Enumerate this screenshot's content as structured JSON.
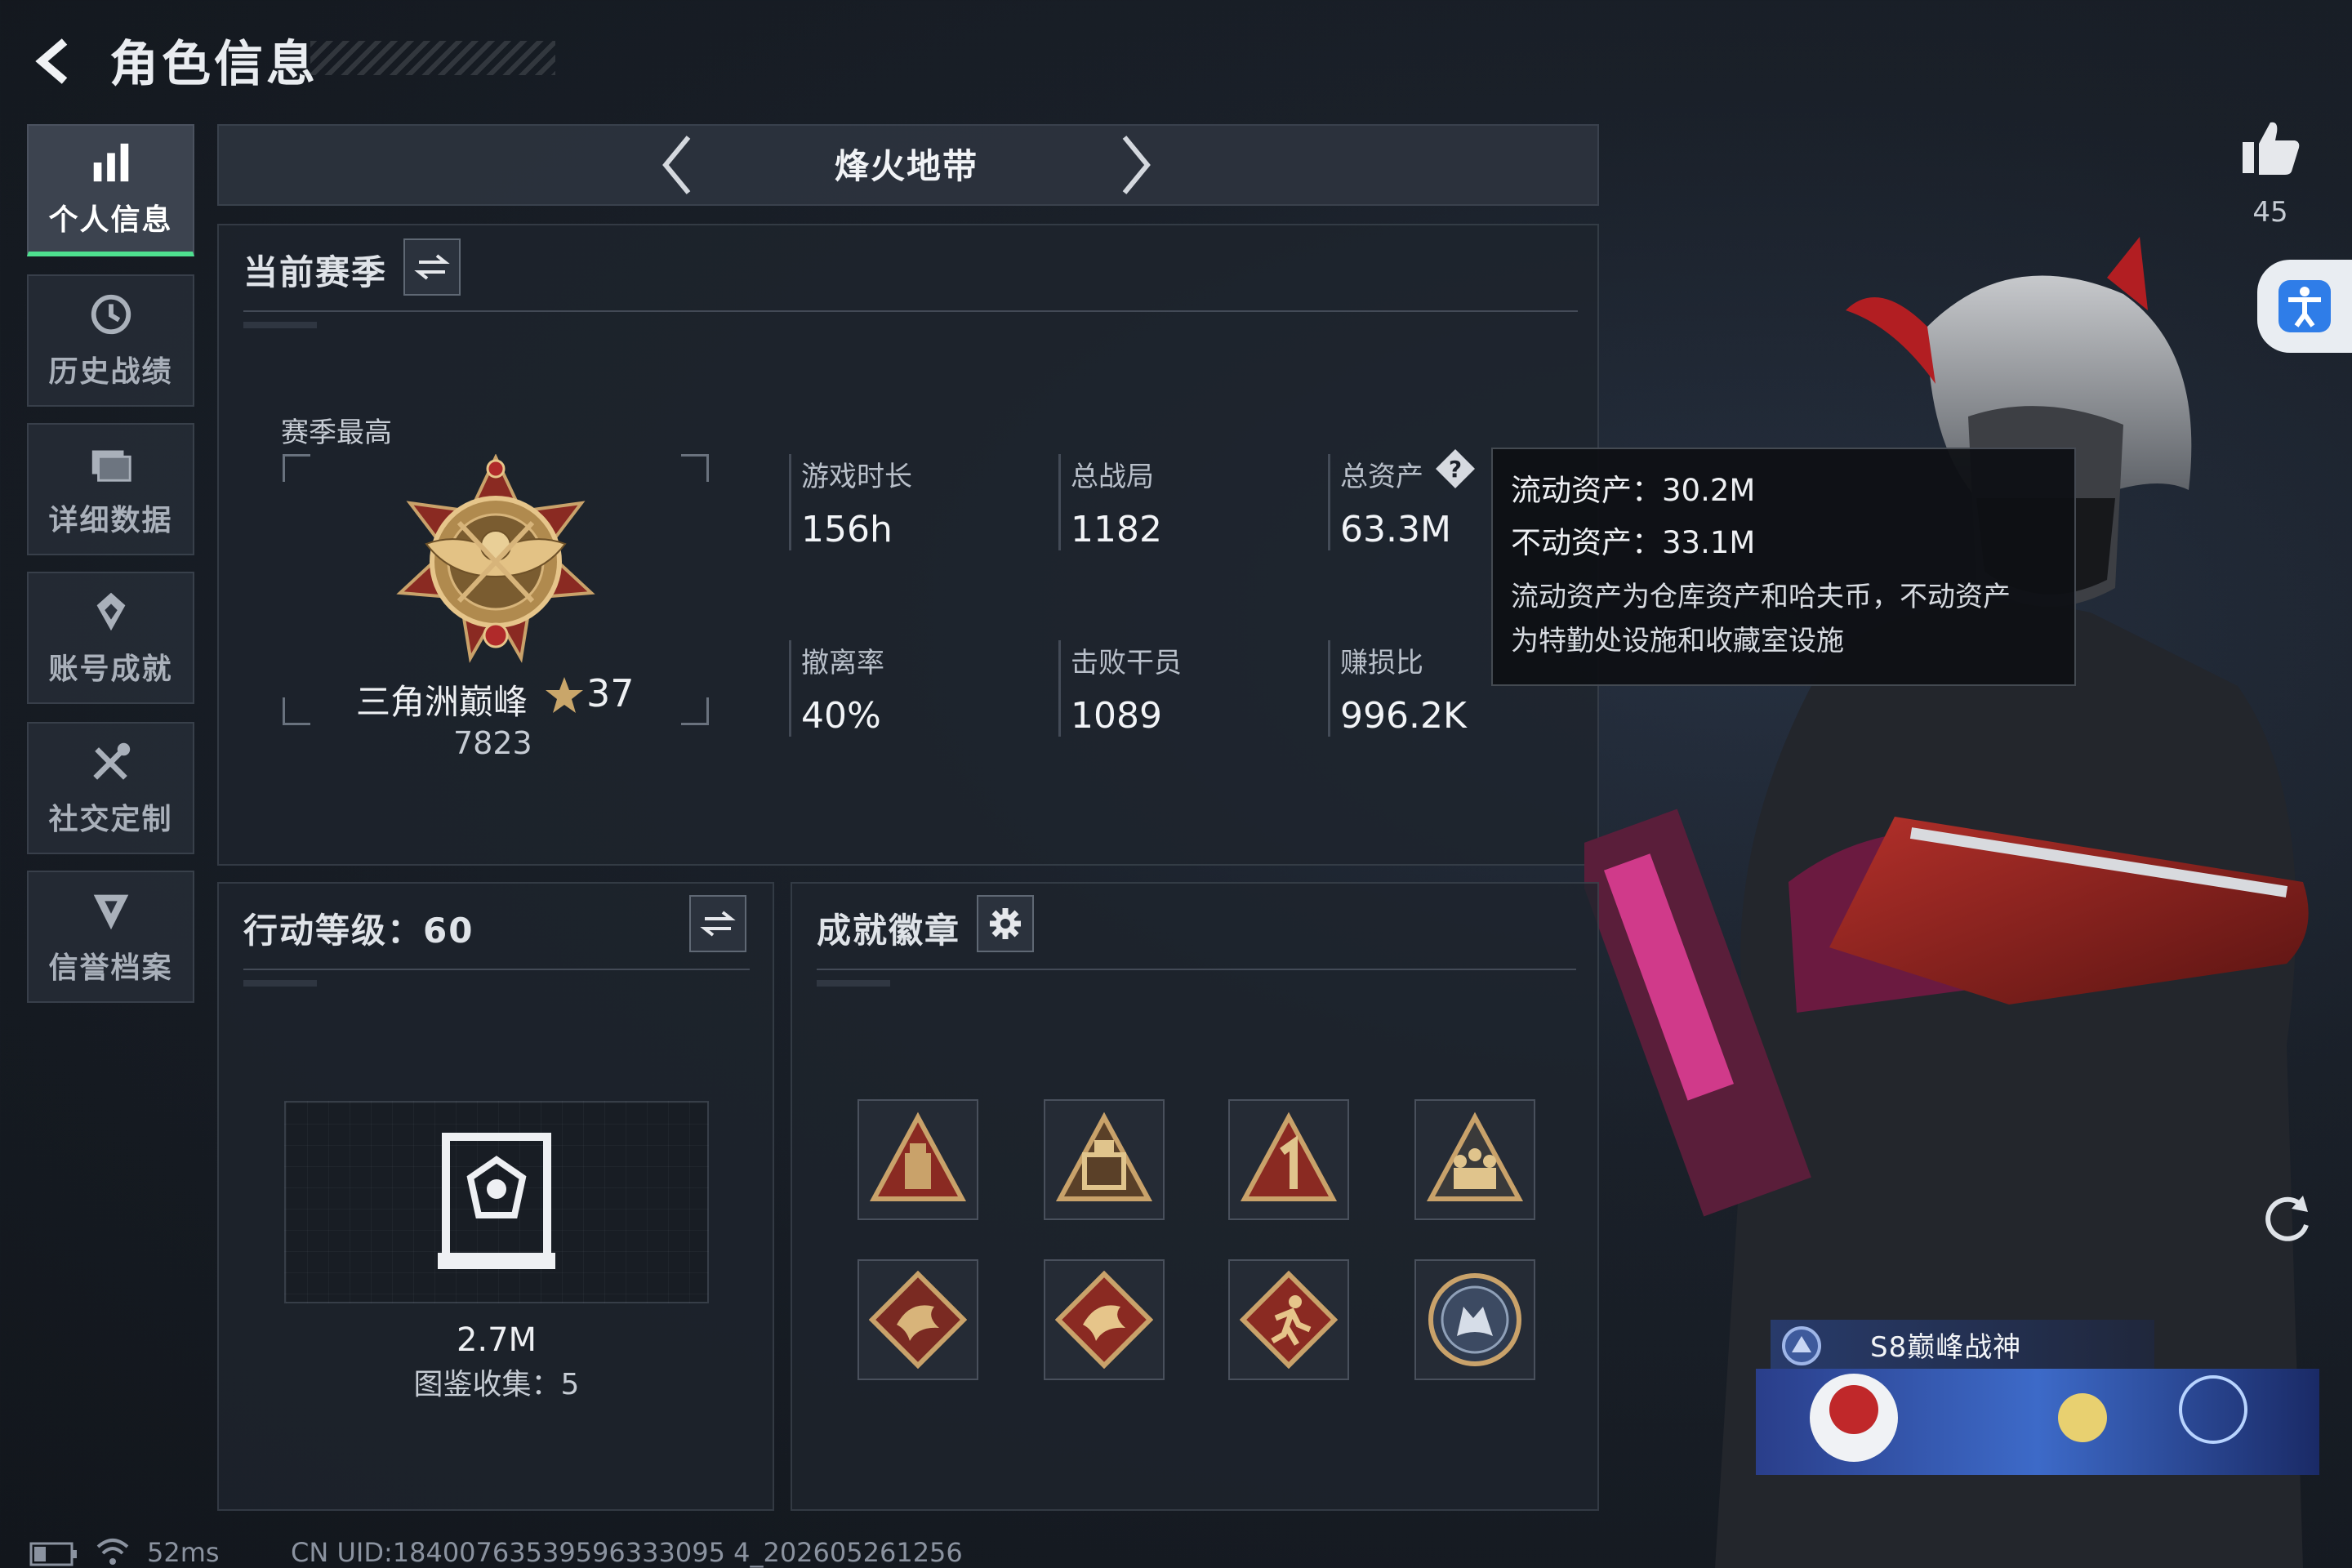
{
  "header": {
    "title": "角色信息"
  },
  "sidebar": {
    "items": [
      {
        "label": "个人信息",
        "icon": "bar-chart-icon",
        "active": true
      },
      {
        "label": "历史战绩",
        "icon": "history-icon",
        "active": false
      },
      {
        "label": "详细数据",
        "icon": "folder-icon",
        "active": false
      },
      {
        "label": "账号成就",
        "icon": "achievement-icon",
        "active": false
      },
      {
        "label": "社交定制",
        "icon": "tools-icon",
        "active": false
      },
      {
        "label": "信誉档案",
        "icon": "shield-icon",
        "active": false
      }
    ]
  },
  "mode": {
    "name": "烽火地带"
  },
  "season": {
    "title": "当前赛季",
    "best_label": "赛季最高",
    "rank_name": "三角洲巅峰",
    "rank_stars": "37",
    "rank_score": "7823",
    "stats": [
      {
        "label": "游戏时长",
        "value": "156h"
      },
      {
        "label": "总战局",
        "value": "1182"
      },
      {
        "label": "总资产",
        "value": "63.3M"
      },
      {
        "label": "撤离率",
        "value": "40%"
      },
      {
        "label": "击败干员",
        "value": "1089"
      },
      {
        "label": "赚损比",
        "value": "996.2K"
      }
    ]
  },
  "tooltip": {
    "liquid": "流动资产：30.2M",
    "fixed": "不动资产：33.1M",
    "desc_line1": "流动资产为仓库资产和哈夫币，不动资产",
    "desc_line2": "为特勤处设施和收藏室设施"
  },
  "action_level": {
    "title": "行动等级：60",
    "value": "2.7M",
    "collection": "图鉴收集：5"
  },
  "badges": {
    "title": "成就徽章",
    "items": [
      "badge-triangle-tower",
      "badge-triangle-crate",
      "badge-triangle-number-1",
      "badge-triangle-soldiers",
      "badge-diamond-dragon",
      "badge-diamond-dragon-2",
      "badge-diamond-runner",
      "badge-round-wolf"
    ]
  },
  "likes": {
    "count": "45"
  },
  "banner": {
    "title": "S8巅峰战神"
  },
  "status": {
    "ping": "52ms",
    "uid": "CN UID:18400763539596333095 4_202605261256"
  },
  "colors": {
    "accent": "#4ee08f",
    "badge_gold": "#c9a26a",
    "badge_red": "#8a2a22"
  }
}
